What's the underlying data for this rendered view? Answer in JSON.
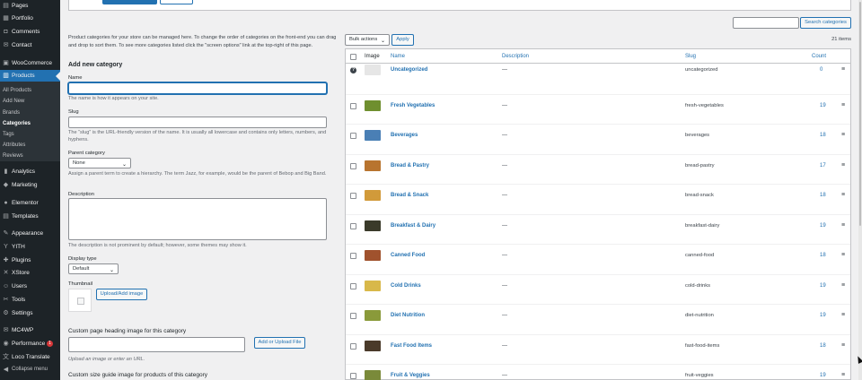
{
  "sidebar": {
    "items": [
      {
        "label": "Pages",
        "icon": "pages-icon"
      },
      {
        "label": "Portfolio",
        "icon": "portfolio-icon"
      },
      {
        "label": "Comments",
        "icon": "comments-icon"
      },
      {
        "label": "Contact",
        "icon": "contact-icon"
      },
      {
        "label": "WooCommerce",
        "icon": "woocommerce-icon"
      },
      {
        "label": "Products",
        "icon": "products-icon"
      },
      {
        "label": "Analytics",
        "icon": "analytics-icon"
      },
      {
        "label": "Marketing",
        "icon": "marketing-icon"
      },
      {
        "label": "Elementor",
        "icon": "elementor-icon"
      },
      {
        "label": "Templates",
        "icon": "templates-icon"
      },
      {
        "label": "Appearance",
        "icon": "appearance-icon"
      },
      {
        "label": "YITH",
        "icon": "yith-icon"
      },
      {
        "label": "Plugins",
        "icon": "plugins-icon"
      },
      {
        "label": "XStore",
        "icon": "xstore-icon"
      },
      {
        "label": "Users",
        "icon": "users-icon"
      },
      {
        "label": "Tools",
        "icon": "tools-icon"
      },
      {
        "label": "Settings",
        "icon": "settings-icon"
      },
      {
        "label": "MC4WP",
        "icon": "mc4wp-icon"
      },
      {
        "label": "Performance",
        "icon": "performance-icon"
      },
      {
        "label": "Loco Translate",
        "icon": "translate-icon"
      },
      {
        "label": "Collapse menu",
        "icon": "collapse-icon"
      }
    ],
    "submenu": [
      "All Products",
      "Add New",
      "Brands",
      "Categories",
      "Tags",
      "Attributes",
      "Reviews"
    ],
    "performance_badge": "1"
  },
  "form": {
    "intro": "Product categories for your store can be managed here. To change the order of categories on the front-end you can drag and drop to sort them. To see more categories listed click the \"screen options\" link at the top-right of this page.",
    "heading": "Add new category",
    "name_label": "Name",
    "name_help": "The name is how it appears on your site.",
    "slug_label": "Slug",
    "slug_help": "The “slug” is the URL-friendly version of the name. It is usually all lowercase and contains only letters, numbers, and hyphens.",
    "parent_label": "Parent category",
    "parent_value": "None",
    "parent_help": "Assign a parent term to create a hierarchy. The term Jazz, for example, would be the parent of Bebop and Big Band.",
    "description_label": "Description",
    "description_help": "The description is not prominent by default; however, some themes may show it.",
    "display_label": "Display type",
    "display_value": "Default",
    "thumbnail_label": "Thumbnail",
    "upload_btn": "Upload/Add image",
    "heading_image_label": "Custom page heading image for this category",
    "add_upload_btn": "Add or Upload File",
    "upload_help": "Upload an image or enter an URL.",
    "size_guide_label": "Custom size guide image for products of this category"
  },
  "list": {
    "search_btn": "Search categories",
    "items_count": "21 items",
    "bulk_actions": "Bulk actions",
    "apply": "Apply",
    "columns": {
      "image": "Image",
      "name": "Name",
      "description": "Description",
      "slug": "Slug",
      "count": "Count"
    },
    "rows": [
      {
        "name": "Uncategorized",
        "description": "—",
        "slug": "uncategorized",
        "count": "0",
        "thumb_color": "#e6e6e6"
      },
      {
        "name": "Fresh Vegetables",
        "description": "—",
        "slug": "fresh-vegetables",
        "count": "19",
        "thumb_color": "#6f8f2f"
      },
      {
        "name": "Beverages",
        "description": "—",
        "slug": "beverages",
        "count": "18",
        "thumb_color": "#4a7fb5"
      },
      {
        "name": "Bread & Pastry",
        "description": "—",
        "slug": "bread-pastry",
        "count": "17",
        "thumb_color": "#b8742f"
      },
      {
        "name": "Bread & Snack",
        "description": "—",
        "slug": "bread-snack",
        "count": "18",
        "thumb_color": "#d19a3a"
      },
      {
        "name": "Breakfast & Dairy",
        "description": "—",
        "slug": "breakfast-dairy",
        "count": "19",
        "thumb_color": "#3a3a2a"
      },
      {
        "name": "Canned Food",
        "description": "—",
        "slug": "canned-food",
        "count": "18",
        "thumb_color": "#a0522d"
      },
      {
        "name": "Cold Drinks",
        "description": "—",
        "slug": "cold-drinks",
        "count": "19",
        "thumb_color": "#d8b84a"
      },
      {
        "name": "Diet Nutrition",
        "description": "—",
        "slug": "diet-nutrition",
        "count": "19",
        "thumb_color": "#8a9a3a"
      },
      {
        "name": "Fast Food Items",
        "description": "—",
        "slug": "fast-food-items",
        "count": "18",
        "thumb_color": "#4a3a2a"
      },
      {
        "name": "Fruit & Veggies",
        "description": "—",
        "slug": "fruit-veggies",
        "count": "19",
        "thumb_color": "#7a8a3a"
      }
    ]
  },
  "colors": {
    "accent": "#2271b1",
    "sidebar_bg": "#1d2327"
  }
}
